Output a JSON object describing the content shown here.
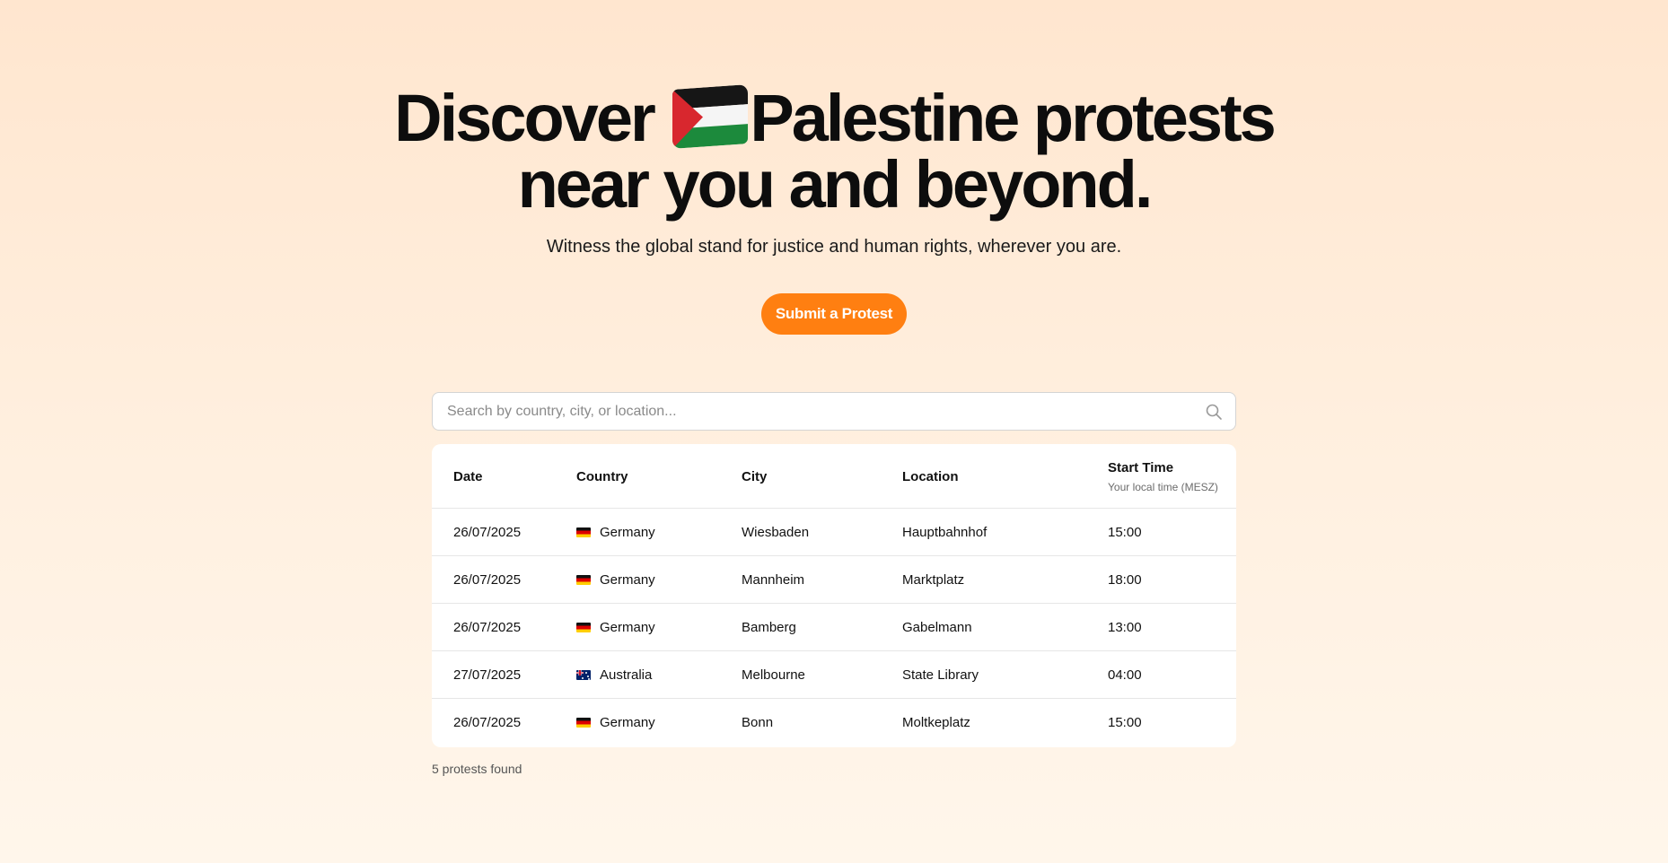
{
  "hero": {
    "title_part1": "Discover ",
    "title_flag": "palestine-flag-icon",
    "title_part2": "Palestine protests",
    "title_line2": "near you and beyond.",
    "subtitle": "Witness the global stand for justice and human rights, wherever you are.",
    "cta_label": "Submit a Protest"
  },
  "search": {
    "placeholder": "Search by country, city, or location...",
    "value": "",
    "icon": "search-icon"
  },
  "table": {
    "headers": {
      "date": "Date",
      "country": "Country",
      "city": "City",
      "location": "Location",
      "start_time": "Start Time",
      "start_time_sub": "Your local time (MESZ)"
    },
    "rows": [
      {
        "date": "26/07/2025",
        "flag": "germany-flag-icon",
        "country": "Germany",
        "city": "Wiesbaden",
        "location": "Hauptbahnhof",
        "time": "15:00"
      },
      {
        "date": "26/07/2025",
        "flag": "germany-flag-icon",
        "country": "Germany",
        "city": "Mannheim",
        "location": "Marktplatz",
        "time": "18:00"
      },
      {
        "date": "26/07/2025",
        "flag": "germany-flag-icon",
        "country": "Germany",
        "city": "Bamberg",
        "location": "Gabelmann",
        "time": "13:00"
      },
      {
        "date": "27/07/2025",
        "flag": "australia-flag-icon",
        "country": "Australia",
        "city": "Melbourne",
        "location": "State Library",
        "time": "04:00"
      },
      {
        "date": "26/07/2025",
        "flag": "germany-flag-icon",
        "country": "Germany",
        "city": "Bonn",
        "location": "Moltkeplatz",
        "time": "15:00"
      }
    ]
  },
  "results": {
    "count_text": "5 protests found"
  },
  "colors": {
    "accent": "#ff7f11",
    "background_top": "#ffe6cf",
    "background_bottom": "#fff6eb"
  }
}
